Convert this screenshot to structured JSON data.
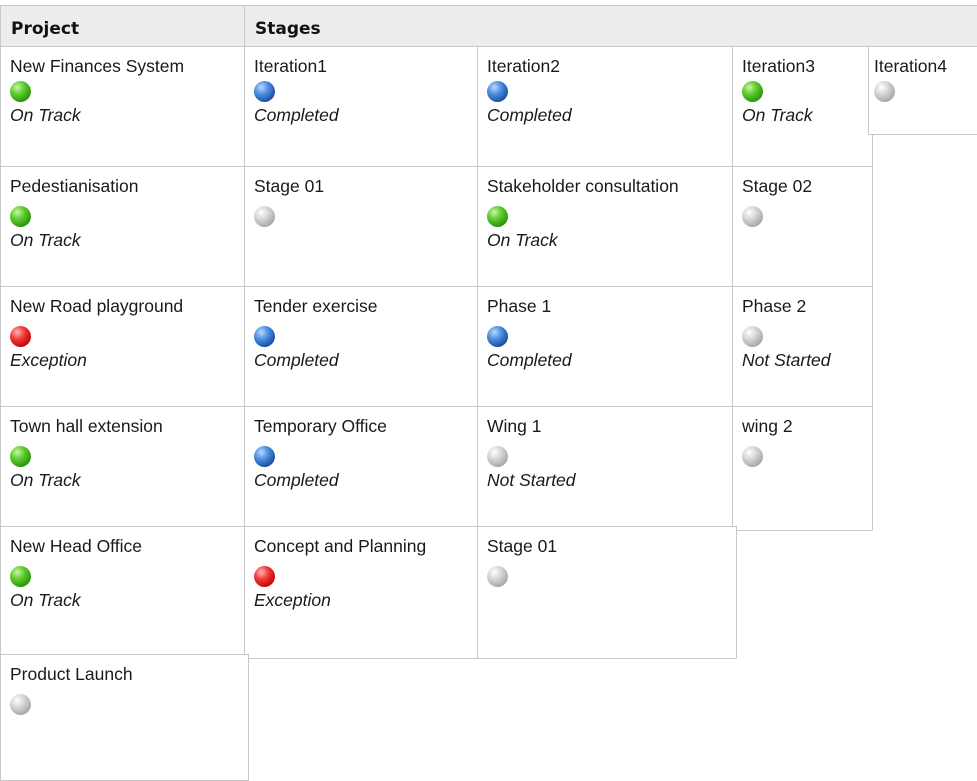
{
  "header": {
    "project_label": "Project",
    "stages_label": "Stages"
  },
  "rows": [
    {
      "project": {
        "name": "New Finances System",
        "dot": "green",
        "status": "On Track"
      },
      "stages": [
        {
          "name": "Iteration1",
          "dot": "blue",
          "status": "Completed"
        },
        {
          "name": "Iteration2",
          "dot": "blue",
          "status": "Completed"
        },
        {
          "name": "Iteration3",
          "dot": "green",
          "status": "On Track"
        },
        {
          "name": "Iteration4",
          "dot": "grey",
          "status": ""
        }
      ]
    },
    {
      "project": {
        "name": "Pedestianisation",
        "dot": "green",
        "status": "On Track"
      },
      "stages": [
        {
          "name": "Stage 01",
          "dot": "grey",
          "status": ""
        },
        {
          "name": "Stakeholder consultation",
          "dot": "green",
          "status": "On Track"
        },
        {
          "name": "Stage 02",
          "dot": "grey",
          "status": ""
        }
      ]
    },
    {
      "project": {
        "name": "New Road playground",
        "dot": "red",
        "status": "Exception"
      },
      "stages": [
        {
          "name": "Tender exercise",
          "dot": "blue",
          "status": "Completed"
        },
        {
          "name": "Phase 1",
          "dot": "blue",
          "status": "Completed"
        },
        {
          "name": "Phase 2",
          "dot": "grey",
          "status": "Not Started"
        }
      ]
    },
    {
      "project": {
        "name": "Town hall extension",
        "dot": "green",
        "status": "On Track"
      },
      "stages": [
        {
          "name": "Temporary Office",
          "dot": "blue",
          "status": "Completed"
        },
        {
          "name": "Wing 1",
          "dot": "grey",
          "status": "Not Started"
        },
        {
          "name": "wing 2",
          "dot": "grey",
          "status": ""
        }
      ]
    },
    {
      "project": {
        "name": "New Head Office",
        "dot": "green",
        "status": "On Track"
      },
      "stages": [
        {
          "name": "Concept and Planning",
          "dot": "red",
          "status": "Exception"
        },
        {
          "name": "Stage 01",
          "dot": "grey",
          "status": ""
        }
      ]
    },
    {
      "project": {
        "name": "Product Launch",
        "dot": "grey",
        "status": ""
      },
      "stages": []
    }
  ]
}
